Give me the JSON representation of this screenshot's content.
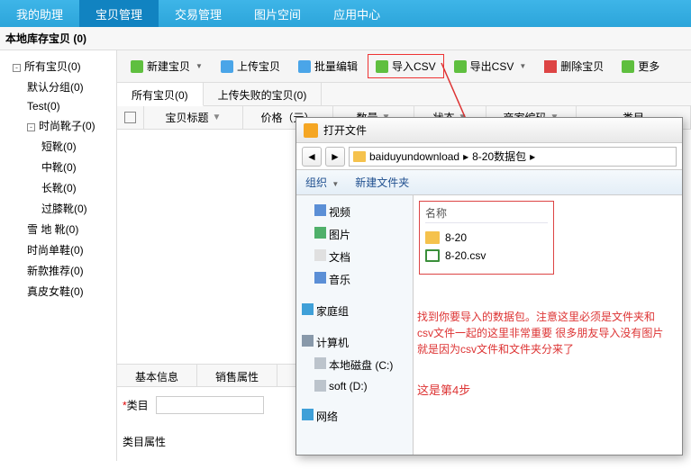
{
  "nav": {
    "tabs": [
      "我的助理",
      "宝贝管理",
      "交易管理",
      "图片空间",
      "应用中心"
    ],
    "active": 1
  },
  "subheader": "本地库存宝贝 (0)",
  "sidebar": [
    {
      "label": "所有宝贝(0)",
      "depth": 0,
      "expand": "-"
    },
    {
      "label": "默认分组(0)",
      "depth": 1
    },
    {
      "label": "Test(0)",
      "depth": 1
    },
    {
      "label": "时尚靴子(0)",
      "depth": 1,
      "expand": "-"
    },
    {
      "label": "短靴(0)",
      "depth": 2
    },
    {
      "label": "中靴(0)",
      "depth": 2
    },
    {
      "label": "长靴(0)",
      "depth": 2
    },
    {
      "label": "过膝靴(0)",
      "depth": 2
    },
    {
      "label": "雪 地 靴(0)",
      "depth": 1
    },
    {
      "label": "时尚单鞋(0)",
      "depth": 1
    },
    {
      "label": "新款推荐(0)",
      "depth": 1
    },
    {
      "label": "真皮女鞋(0)",
      "depth": 1
    }
  ],
  "toolbar": {
    "new": "新建宝贝",
    "upload": "上传宝贝",
    "batch": "批量编辑",
    "import": "导入CSV",
    "export": "导出CSV",
    "delete": "删除宝贝",
    "more": "更多"
  },
  "tabs": {
    "all": "所有宝贝(0)",
    "failed": "上传失败的宝贝(0)"
  },
  "grid": {
    "cols": [
      "宝贝标题",
      "价格（元）",
      "数量",
      "状态",
      "商家编码",
      "类目"
    ]
  },
  "bottom_tabs": [
    "基本信息",
    "销售属性"
  ],
  "form": {
    "category_label": "类目",
    "attrs_label": "类目属性"
  },
  "dialog": {
    "title": "打开文件",
    "path": [
      "baiduyundownload",
      "8-20数据包"
    ],
    "bar": {
      "org": "组织",
      "newfolder": "新建文件夹"
    },
    "side": [
      {
        "label": "视频",
        "ind": true,
        "ic": "#5b8fd6"
      },
      {
        "label": "图片",
        "ind": true,
        "ic": "#4fb06a"
      },
      {
        "label": "文档",
        "ind": true,
        "ic": "#e0e0e0"
      },
      {
        "label": "音乐",
        "ind": true,
        "ic": "#5b8fd6"
      },
      {
        "label": "家庭组",
        "ind": false,
        "ic": "#3fa0d8"
      },
      {
        "label": "计算机",
        "ind": false,
        "ic": "#8899aa"
      },
      {
        "label": "本地磁盘 (C:)",
        "ind": true,
        "ic": "#bcc4cc"
      },
      {
        "label": "soft (D:)",
        "ind": true,
        "ic": "#bcc4cc"
      },
      {
        "label": "网络",
        "ind": false,
        "ic": "#3fa0d8"
      }
    ],
    "list_hdr": "名称",
    "files": [
      {
        "name": "8-20",
        "type": "fold"
      },
      {
        "name": "8-20.csv",
        "type": "csv"
      }
    ],
    "note": "找到你要导入的数据包。注意这里必须是文件夹和csv文件一起的这里非常重要 很多朋友导入没有图片 就是因为csv文件和文件夹分来了",
    "step": "这是第4步"
  }
}
